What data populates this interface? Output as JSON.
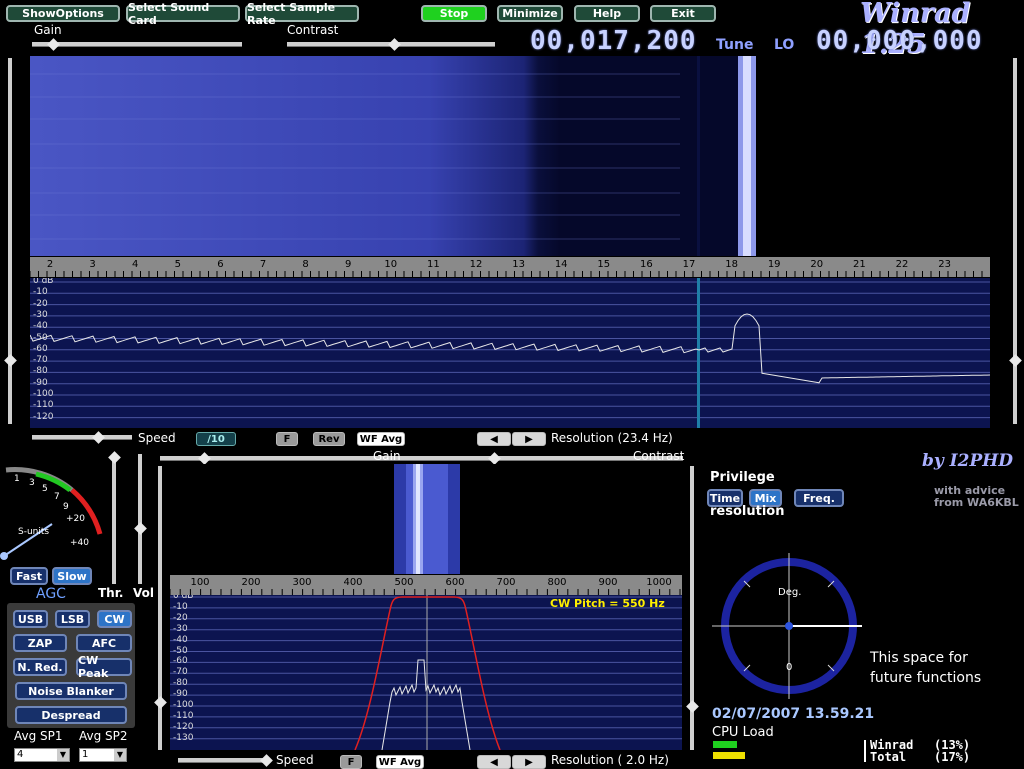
{
  "toolbar": {
    "show_options": "ShowOptions",
    "select_card": "Select Sound Card",
    "select_rate": "Select Sample Rate",
    "stop": "Stop",
    "minimize": "Minimize",
    "help": "Help",
    "exit": "Exit"
  },
  "brand": {
    "title": "Winrad 1.25",
    "author": "by I2PHD",
    "advice_1": "with advice",
    "advice_2": "from WA6KBL"
  },
  "tuning": {
    "tune_value": "00,017,200",
    "tune_label": "Tune",
    "lo_label": "LO",
    "lo_value": "00,000,000"
  },
  "top_sliders": {
    "gain": "Gain",
    "contrast": "Contrast"
  },
  "main_spectrum": {
    "freq_ticks": [
      "2",
      "3",
      "4",
      "5",
      "6",
      "7",
      "8",
      "9",
      "10",
      "11",
      "12",
      "13",
      "14",
      "15",
      "16",
      "17",
      "18",
      "19",
      "20",
      "21",
      "22",
      "23"
    ],
    "db_labels": [
      "0 dB",
      "-10",
      "-20",
      "-30",
      "-40",
      "-50",
      "-60",
      "-70",
      "-80",
      "-90",
      "-100",
      "-110",
      "-120"
    ]
  },
  "speed_row": {
    "speed": "Speed",
    "speed_value": "/10",
    "f": "F",
    "rev": "Rev",
    "wf_avg": "WF Avg",
    "resolution": "Resolution (23.4 Hz)"
  },
  "smeter": {
    "labels": [
      "1",
      "3",
      "5",
      "7",
      "9",
      "+20",
      "+40"
    ],
    "units": "S-units"
  },
  "agc": {
    "fast": "Fast",
    "slow": "Slow",
    "agc": "AGC",
    "thr": "Thr.",
    "vol": "Vol"
  },
  "modes": {
    "usb": "USB",
    "lsb": "LSB",
    "cw": "CW",
    "zap": "ZAP",
    "afc": "AFC",
    "nred": "N. Red.",
    "cwpeak": "CW Peak",
    "nb": "Noise Blanker",
    "despread": "Despread"
  },
  "avg": {
    "sp1": "Avg SP1",
    "sp2": "Avg SP2",
    "sp1_val": "4",
    "sp2_val": "1"
  },
  "sub_panel": {
    "gain": "Gain",
    "contrast": "Contrast",
    "freq_ticks": [
      "100",
      "200",
      "300",
      "400",
      "500",
      "600",
      "700",
      "800",
      "900",
      "1000"
    ],
    "db_labels": [
      "0 dB",
      "-10",
      "-20",
      "-30",
      "-40",
      "-50",
      "-60",
      "-70",
      "-80",
      "-90",
      "-100",
      "-110",
      "-120",
      "-130"
    ],
    "cw_pitch": "CW Pitch = 550 Hz",
    "speed": "Speed",
    "f": "F",
    "wf_avg": "WF Avg",
    "resolution": "Resolution ( 2.0 Hz)"
  },
  "privilege": {
    "title": "Privilege",
    "time": "Time",
    "mix": "Mix",
    "freq": "Freq.",
    "resolution": "resolution"
  },
  "dial": {
    "deg": "Deg.",
    "zero": "0"
  },
  "future": {
    "line1": "This space for",
    "line2": "future functions"
  },
  "status": {
    "datetime": "02/07/2007 13.59.21",
    "cpu_label": "CPU Load",
    "winrad": "Winrad",
    "winrad_pct": "(13%)",
    "total": "Total",
    "total_pct": "(17%)",
    "winrad_load": 0.13,
    "total_load": 0.17
  },
  "colors": {
    "accent_green": "#1fd11f",
    "panel_blue": "#0c1450",
    "waterfall_blue": "#3a46b0",
    "trace_red": "#e02020"
  }
}
